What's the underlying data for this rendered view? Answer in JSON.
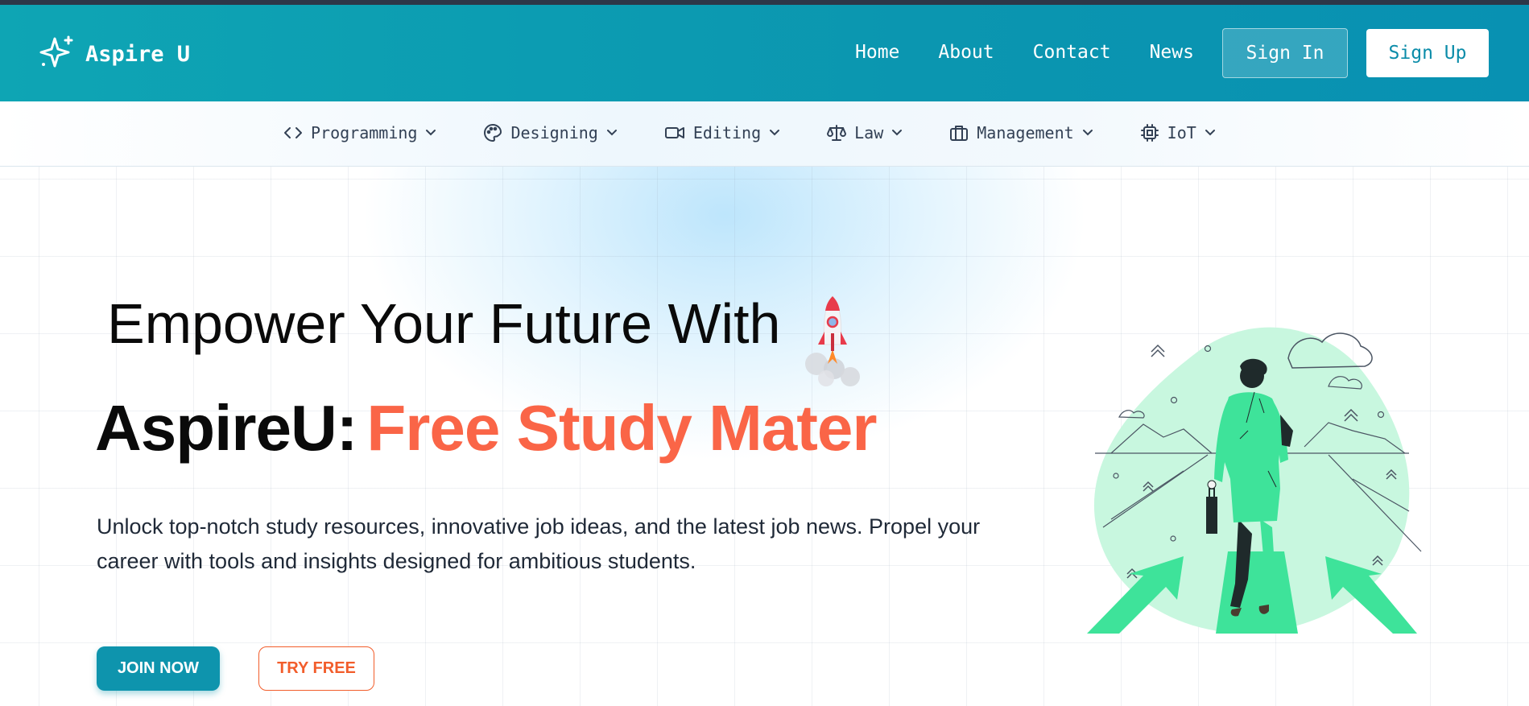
{
  "header": {
    "brand": "Aspire U",
    "nav": [
      "Home",
      "About",
      "Contact",
      "News"
    ],
    "sign_in": "Sign In",
    "sign_up": "Sign Up"
  },
  "categories": [
    {
      "label": "Programming",
      "icon": "code-icon"
    },
    {
      "label": "Designing",
      "icon": "palette-icon"
    },
    {
      "label": "Editing",
      "icon": "video-icon"
    },
    {
      "label": "Law",
      "icon": "scale-icon"
    },
    {
      "label": "Management",
      "icon": "briefcase-icon"
    },
    {
      "label": "IoT",
      "icon": "chip-icon"
    }
  ],
  "hero": {
    "heading_line1": "Empower Your Future With",
    "heading_brand": "AspireU:",
    "heading_highlight": "Free Study Mater",
    "description": "Unlock top-notch study resources, innovative job ideas, and the latest job news. Propel your career with tools and insights designed for ambitious students.",
    "join_label": "JOIN NOW",
    "try_label": "TRY FREE"
  },
  "colors": {
    "header_teal": "#0ea5b4",
    "accent_orange": "#fa6547",
    "button_teal": "#0e94ad",
    "illustration_green": "#3ee39a"
  }
}
